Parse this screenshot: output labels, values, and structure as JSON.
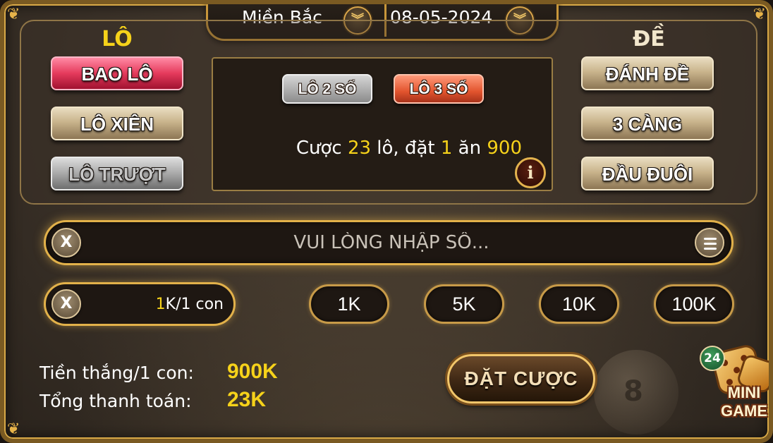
{
  "header": {
    "region": "Miền Bắc",
    "date": "08-05-2024"
  },
  "lo": {
    "title": "LÔ",
    "buttons": [
      "BAO LÔ",
      "LÔ XIÊN",
      "LÔ TRƯỢT"
    ],
    "selected": "BAO LÔ"
  },
  "de": {
    "title": "ĐỀ",
    "buttons": [
      "ĐÁNH ĐỀ",
      "3 CÀNG",
      "ĐẦU ĐUÔI"
    ]
  },
  "center": {
    "modes": [
      "LÔ 2 SỐ",
      "LÔ 3 SỐ"
    ],
    "selected_mode": "LÔ 3 SỐ",
    "bet_prefix": "Cược",
    "bet_count": "23",
    "bet_mid1": "lô, đặt",
    "bet_stake": "1",
    "bet_mid2": "ăn",
    "bet_payout": "900",
    "info_icon": "i"
  },
  "input": {
    "placeholder": "VUI LÒNG NHẬP SỐ...",
    "clear_icon": "X"
  },
  "stake": {
    "clear_icon": "X",
    "amount": "1",
    "unit": "K/1 con"
  },
  "chips": [
    "1K",
    "5K",
    "10K",
    "100K"
  ],
  "summary": {
    "win_label": "Tiền thắng/1 con:",
    "win_value": "900K",
    "total_label": "Tổng thanh toán:",
    "total_value": "23K"
  },
  "place_bet_label": "ĐẶT CƯỢC",
  "mini_game": {
    "badge": "24",
    "line1": "MINI",
    "line2": "GAME"
  },
  "deco": {
    "ball_number": "8"
  },
  "colors": {
    "accent_gold": "#f6d21a",
    "frame_gold": "#e2b14a",
    "selected_red": "#e53a5c",
    "selected_orange": "#e2542e"
  }
}
